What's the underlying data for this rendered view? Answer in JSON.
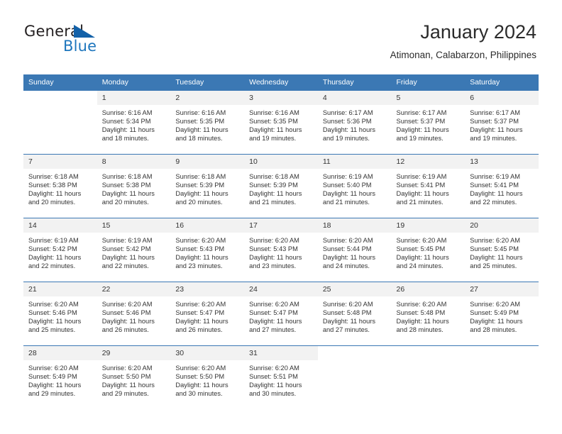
{
  "brand": {
    "name_part1": "General",
    "name_part2": "Blue",
    "triangle_icon": "blue-triangle-logo-mark",
    "colors": {
      "dark": "#231f20",
      "blue": "#1e76bd",
      "triangle": "#1361a8"
    }
  },
  "header": {
    "title": "January 2024",
    "subtitle": "Atimonan, Calabarzon, Philippines"
  },
  "calendar": {
    "accent_color": "#3b78b4",
    "daynum_band_color": "#f2f2f2",
    "weekday_headers": [
      "Sunday",
      "Monday",
      "Tuesday",
      "Wednesday",
      "Thursday",
      "Friday",
      "Saturday"
    ],
    "weeks": [
      [
        {
          "day": "",
          "sunrise": "",
          "sunset": "",
          "daylight_line1": "",
          "daylight_line2": ""
        },
        {
          "day": "1",
          "sunrise": "Sunrise: 6:16 AM",
          "sunset": "Sunset: 5:34 PM",
          "daylight_line1": "Daylight: 11 hours",
          "daylight_line2": "and 18 minutes."
        },
        {
          "day": "2",
          "sunrise": "Sunrise: 6:16 AM",
          "sunset": "Sunset: 5:35 PM",
          "daylight_line1": "Daylight: 11 hours",
          "daylight_line2": "and 18 minutes."
        },
        {
          "day": "3",
          "sunrise": "Sunrise: 6:16 AM",
          "sunset": "Sunset: 5:35 PM",
          "daylight_line1": "Daylight: 11 hours",
          "daylight_line2": "and 19 minutes."
        },
        {
          "day": "4",
          "sunrise": "Sunrise: 6:17 AM",
          "sunset": "Sunset: 5:36 PM",
          "daylight_line1": "Daylight: 11 hours",
          "daylight_line2": "and 19 minutes."
        },
        {
          "day": "5",
          "sunrise": "Sunrise: 6:17 AM",
          "sunset": "Sunset: 5:37 PM",
          "daylight_line1": "Daylight: 11 hours",
          "daylight_line2": "and 19 minutes."
        },
        {
          "day": "6",
          "sunrise": "Sunrise: 6:17 AM",
          "sunset": "Sunset: 5:37 PM",
          "daylight_line1": "Daylight: 11 hours",
          "daylight_line2": "and 19 minutes."
        }
      ],
      [
        {
          "day": "7",
          "sunrise": "Sunrise: 6:18 AM",
          "sunset": "Sunset: 5:38 PM",
          "daylight_line1": "Daylight: 11 hours",
          "daylight_line2": "and 20 minutes."
        },
        {
          "day": "8",
          "sunrise": "Sunrise: 6:18 AM",
          "sunset": "Sunset: 5:38 PM",
          "daylight_line1": "Daylight: 11 hours",
          "daylight_line2": "and 20 minutes."
        },
        {
          "day": "9",
          "sunrise": "Sunrise: 6:18 AM",
          "sunset": "Sunset: 5:39 PM",
          "daylight_line1": "Daylight: 11 hours",
          "daylight_line2": "and 20 minutes."
        },
        {
          "day": "10",
          "sunrise": "Sunrise: 6:18 AM",
          "sunset": "Sunset: 5:39 PM",
          "daylight_line1": "Daylight: 11 hours",
          "daylight_line2": "and 21 minutes."
        },
        {
          "day": "11",
          "sunrise": "Sunrise: 6:19 AM",
          "sunset": "Sunset: 5:40 PM",
          "daylight_line1": "Daylight: 11 hours",
          "daylight_line2": "and 21 minutes."
        },
        {
          "day": "12",
          "sunrise": "Sunrise: 6:19 AM",
          "sunset": "Sunset: 5:41 PM",
          "daylight_line1": "Daylight: 11 hours",
          "daylight_line2": "and 21 minutes."
        },
        {
          "day": "13",
          "sunrise": "Sunrise: 6:19 AM",
          "sunset": "Sunset: 5:41 PM",
          "daylight_line1": "Daylight: 11 hours",
          "daylight_line2": "and 22 minutes."
        }
      ],
      [
        {
          "day": "14",
          "sunrise": "Sunrise: 6:19 AM",
          "sunset": "Sunset: 5:42 PM",
          "daylight_line1": "Daylight: 11 hours",
          "daylight_line2": "and 22 minutes."
        },
        {
          "day": "15",
          "sunrise": "Sunrise: 6:19 AM",
          "sunset": "Sunset: 5:42 PM",
          "daylight_line1": "Daylight: 11 hours",
          "daylight_line2": "and 22 minutes."
        },
        {
          "day": "16",
          "sunrise": "Sunrise: 6:20 AM",
          "sunset": "Sunset: 5:43 PM",
          "daylight_line1": "Daylight: 11 hours",
          "daylight_line2": "and 23 minutes."
        },
        {
          "day": "17",
          "sunrise": "Sunrise: 6:20 AM",
          "sunset": "Sunset: 5:43 PM",
          "daylight_line1": "Daylight: 11 hours",
          "daylight_line2": "and 23 minutes."
        },
        {
          "day": "18",
          "sunrise": "Sunrise: 6:20 AM",
          "sunset": "Sunset: 5:44 PM",
          "daylight_line1": "Daylight: 11 hours",
          "daylight_line2": "and 24 minutes."
        },
        {
          "day": "19",
          "sunrise": "Sunrise: 6:20 AM",
          "sunset": "Sunset: 5:45 PM",
          "daylight_line1": "Daylight: 11 hours",
          "daylight_line2": "and 24 minutes."
        },
        {
          "day": "20",
          "sunrise": "Sunrise: 6:20 AM",
          "sunset": "Sunset: 5:45 PM",
          "daylight_line1": "Daylight: 11 hours",
          "daylight_line2": "and 25 minutes."
        }
      ],
      [
        {
          "day": "21",
          "sunrise": "Sunrise: 6:20 AM",
          "sunset": "Sunset: 5:46 PM",
          "daylight_line1": "Daylight: 11 hours",
          "daylight_line2": "and 25 minutes."
        },
        {
          "day": "22",
          "sunrise": "Sunrise: 6:20 AM",
          "sunset": "Sunset: 5:46 PM",
          "daylight_line1": "Daylight: 11 hours",
          "daylight_line2": "and 26 minutes."
        },
        {
          "day": "23",
          "sunrise": "Sunrise: 6:20 AM",
          "sunset": "Sunset: 5:47 PM",
          "daylight_line1": "Daylight: 11 hours",
          "daylight_line2": "and 26 minutes."
        },
        {
          "day": "24",
          "sunrise": "Sunrise: 6:20 AM",
          "sunset": "Sunset: 5:47 PM",
          "daylight_line1": "Daylight: 11 hours",
          "daylight_line2": "and 27 minutes."
        },
        {
          "day": "25",
          "sunrise": "Sunrise: 6:20 AM",
          "sunset": "Sunset: 5:48 PM",
          "daylight_line1": "Daylight: 11 hours",
          "daylight_line2": "and 27 minutes."
        },
        {
          "day": "26",
          "sunrise": "Sunrise: 6:20 AM",
          "sunset": "Sunset: 5:48 PM",
          "daylight_line1": "Daylight: 11 hours",
          "daylight_line2": "and 28 minutes."
        },
        {
          "day": "27",
          "sunrise": "Sunrise: 6:20 AM",
          "sunset": "Sunset: 5:49 PM",
          "daylight_line1": "Daylight: 11 hours",
          "daylight_line2": "and 28 minutes."
        }
      ],
      [
        {
          "day": "28",
          "sunrise": "Sunrise: 6:20 AM",
          "sunset": "Sunset: 5:49 PM",
          "daylight_line1": "Daylight: 11 hours",
          "daylight_line2": "and 29 minutes."
        },
        {
          "day": "29",
          "sunrise": "Sunrise: 6:20 AM",
          "sunset": "Sunset: 5:50 PM",
          "daylight_line1": "Daylight: 11 hours",
          "daylight_line2": "and 29 minutes."
        },
        {
          "day": "30",
          "sunrise": "Sunrise: 6:20 AM",
          "sunset": "Sunset: 5:50 PM",
          "daylight_line1": "Daylight: 11 hours",
          "daylight_line2": "and 30 minutes."
        },
        {
          "day": "31",
          "sunrise": "Sunrise: 6:20 AM",
          "sunset": "Sunset: 5:51 PM",
          "daylight_line1": "Daylight: 11 hours",
          "daylight_line2": "and 30 minutes."
        },
        {
          "day": "",
          "sunrise": "",
          "sunset": "",
          "daylight_line1": "",
          "daylight_line2": ""
        },
        {
          "day": "",
          "sunrise": "",
          "sunset": "",
          "daylight_line1": "",
          "daylight_line2": ""
        },
        {
          "day": "",
          "sunrise": "",
          "sunset": "",
          "daylight_line1": "",
          "daylight_line2": ""
        }
      ]
    ]
  }
}
